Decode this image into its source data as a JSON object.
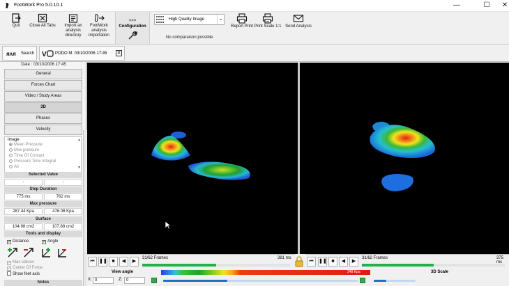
{
  "window": {
    "title": "FootWork Pro 5.0.10.1",
    "minimize": "—",
    "maximize": "☐",
    "close": "✕"
  },
  "toolbar": {
    "quit": "Quit",
    "close_all_tabs": "Close All Tabs",
    "import_1": "Import an",
    "import_2": "analysis",
    "import_3": "directory",
    "fw_import_1": "FootWork",
    "fw_import_2": "analysis",
    "fw_import_3": "importation",
    "config_arrows": ">>>",
    "configuration": "Configuration",
    "quality_value": "High Quality Image",
    "no_comparison": "No comparaison possible",
    "report_print": "Report Print",
    "print_scale": "Print Scale 1:1",
    "send_analysis": "Send Analysis"
  },
  "tabs": {
    "search": "Search",
    "patient": "PODO M. 03/10/2006 17:45",
    "patient_close": "✕"
  },
  "left": {
    "date": "Date : 03/10/2006 17:45",
    "sections": [
      "General",
      "Forces Chart",
      "Video / Study Areas",
      "3D",
      "Phases",
      "Velocity"
    ],
    "image_title": "Image",
    "image_options": [
      "Mean Pressure",
      "Max pressure",
      "Time Of Contact",
      "Pressure Time Integral",
      "All"
    ],
    "scroll_up": "▲",
    "scroll_down": "▼",
    "selected_value_head": "Selected Value",
    "selected_values": [
      "-",
      "-"
    ],
    "step_duration_head": "Step Duration",
    "step_durations": [
      "775 ms",
      "762 ms"
    ],
    "max_pressure_head": "Max pressure",
    "max_pressures": [
      "287.44 Kpa",
      "476.06 Kpa"
    ],
    "surface_head": "Surface",
    "surfaces": [
      "104.98 cm2",
      "107.88 cm2"
    ],
    "tools_head": "Tools and display",
    "distance": "Distance",
    "angle": "Angle",
    "max_values": "Max Values",
    "center_of_force": "Center Of Force",
    "show_feet_axis": "Show feet axis",
    "notes_head": "Notes",
    "check_mark": "✓"
  },
  "player_left": {
    "frames": "31/62 Frames",
    "ms": "381 ms",
    "progress": 0.5
  },
  "player_right": {
    "frames": "31/62 Frames",
    "ms": "375 ms",
    "progress": 0.5
  },
  "bottom": {
    "view_angle": "View angle",
    "scale_max": "348 Kpa",
    "scale_3d": "3D Scale",
    "x_label": "X:",
    "x_value": "0",
    "z_label": "Z:",
    "z_value": "0",
    "view_slider": 0.33,
    "scale_slider": 0.3
  },
  "buttons": {
    "first": "⏮",
    "play_pause": "❚❚",
    "stop": "■",
    "prev": "◀",
    "next": "▶"
  },
  "colors": {
    "view_background": "#000000",
    "frame_progress": "#22b14c",
    "slider": "#1a73c8"
  }
}
